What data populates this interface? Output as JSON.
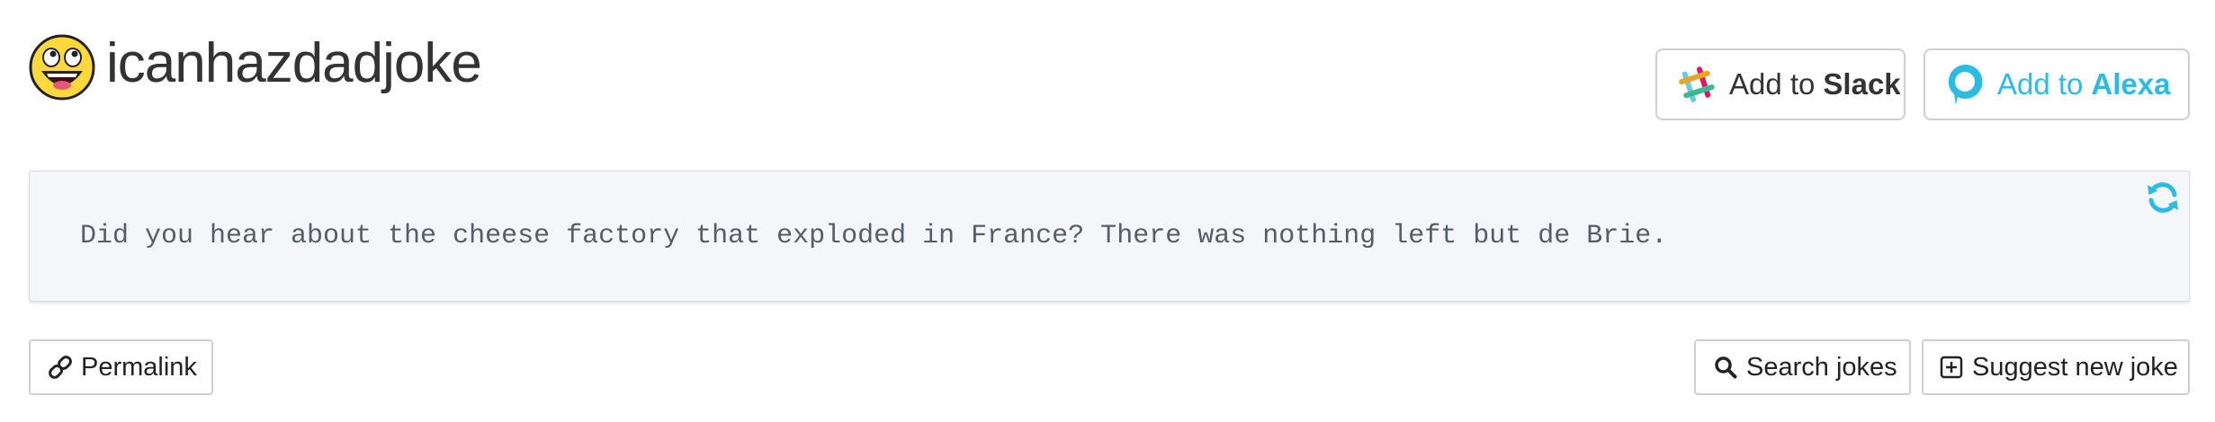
{
  "header": {
    "site_title": "icanhazdadjoke",
    "logo_icon": "awesome-face-icon"
  },
  "integrations": {
    "slack": {
      "prefix": "Add to ",
      "name": "Slack",
      "icon": "slack-icon"
    },
    "alexa": {
      "prefix": "Add to ",
      "name": "Alexa",
      "icon": "alexa-icon",
      "color": "#2bbbe3"
    }
  },
  "joke": {
    "text": "Did you hear about the cheese factory that exploded in France? There was nothing left but de Brie.",
    "refresh_icon": "refresh-icon",
    "refresh_color": "#2bbbe3"
  },
  "actions": {
    "permalink_label": "Permalink",
    "search_label": "Search jokes",
    "suggest_label": "Suggest new joke"
  },
  "colors": {
    "card_background": "#f5f6f9",
    "border": "#cfcfcf",
    "accent": "#2bbbe3"
  }
}
